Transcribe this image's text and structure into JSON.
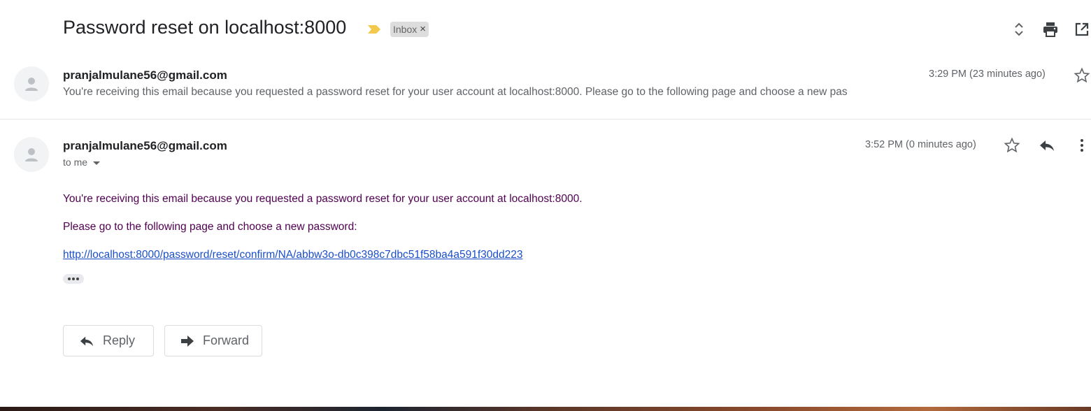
{
  "thread": {
    "subject": "Password reset on localhost:8000",
    "label_chip": "Inbox",
    "label_chip_close": "×",
    "header_icons": [
      "expand-collapse-icon",
      "print-icon",
      "open-new-window-icon"
    ],
    "important_color": "#f2c94c"
  },
  "messages": [
    {
      "sender": "pranjalmulane56@gmail.com",
      "time": "3:29 PM (23 minutes ago)",
      "snippet": "You're receiving this email because you requested a password reset for your user account at localhost:8000. Please go to the following page and choose a new pas",
      "collapsed": true
    },
    {
      "sender": "pranjalmulane56@gmail.com",
      "recipient": "to me",
      "time": "3:52 PM (0 minutes ago)",
      "body": [
        "You're receiving this email because you requested a password reset for your user account at localhost:8000.",
        "Please go to the following page and choose a new password:"
      ],
      "link": "http://localhost:8000/password/reset/confirm/NA/abbw3o-db0c398c7dbc51f58ba4a591f30dd223",
      "collapsed": false
    }
  ],
  "actions": {
    "reply": "Reply",
    "forward": "Forward"
  },
  "colors": {
    "body_text": "#500050",
    "link": "#1a4ec9",
    "muted": "#5f6368"
  }
}
